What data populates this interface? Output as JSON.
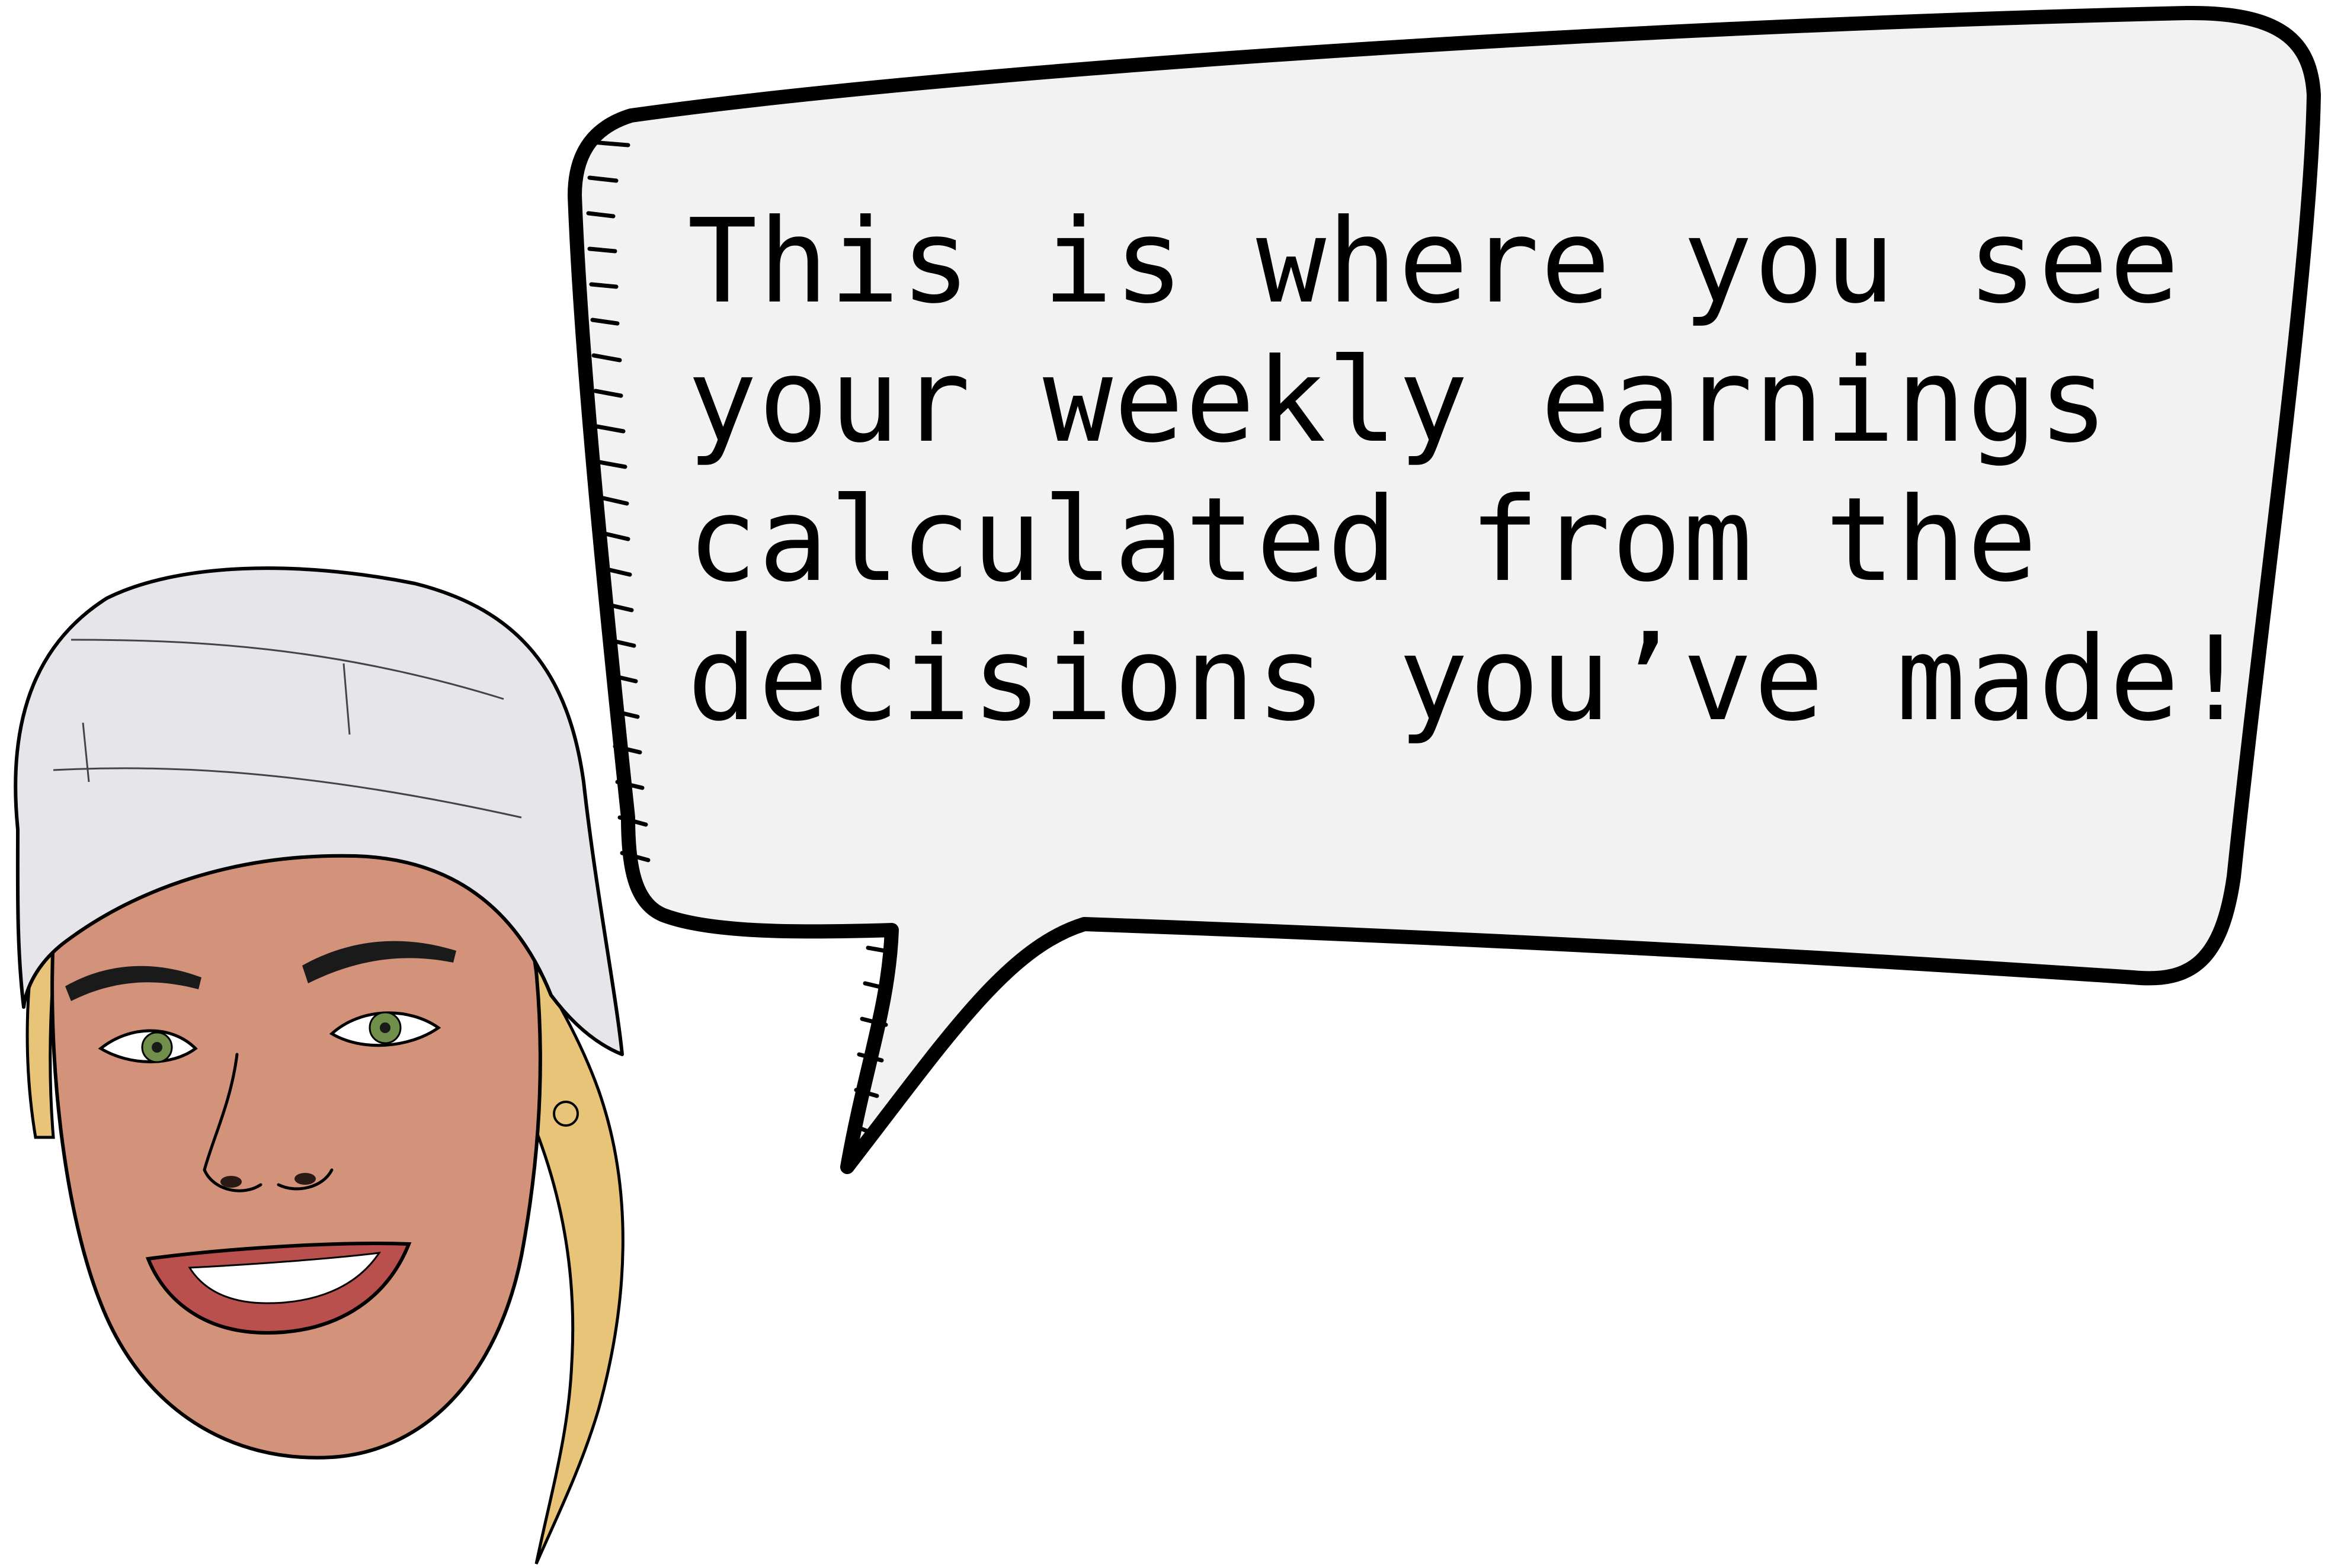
{
  "speech_bubble": {
    "lines": [
      "This is where you see",
      "your weekly earnings",
      "calculated from the",
      "decisions you’ve made!"
    ]
  },
  "character": {
    "hat_color": "#e6e6ea",
    "skin_color": "#d3937a",
    "hair_color": "#e8c478",
    "eye_color": "#6f8f4a",
    "lip_color": "#b9504e"
  },
  "bubble_fill": "#f2f2f2",
  "outline_color": "#000000"
}
